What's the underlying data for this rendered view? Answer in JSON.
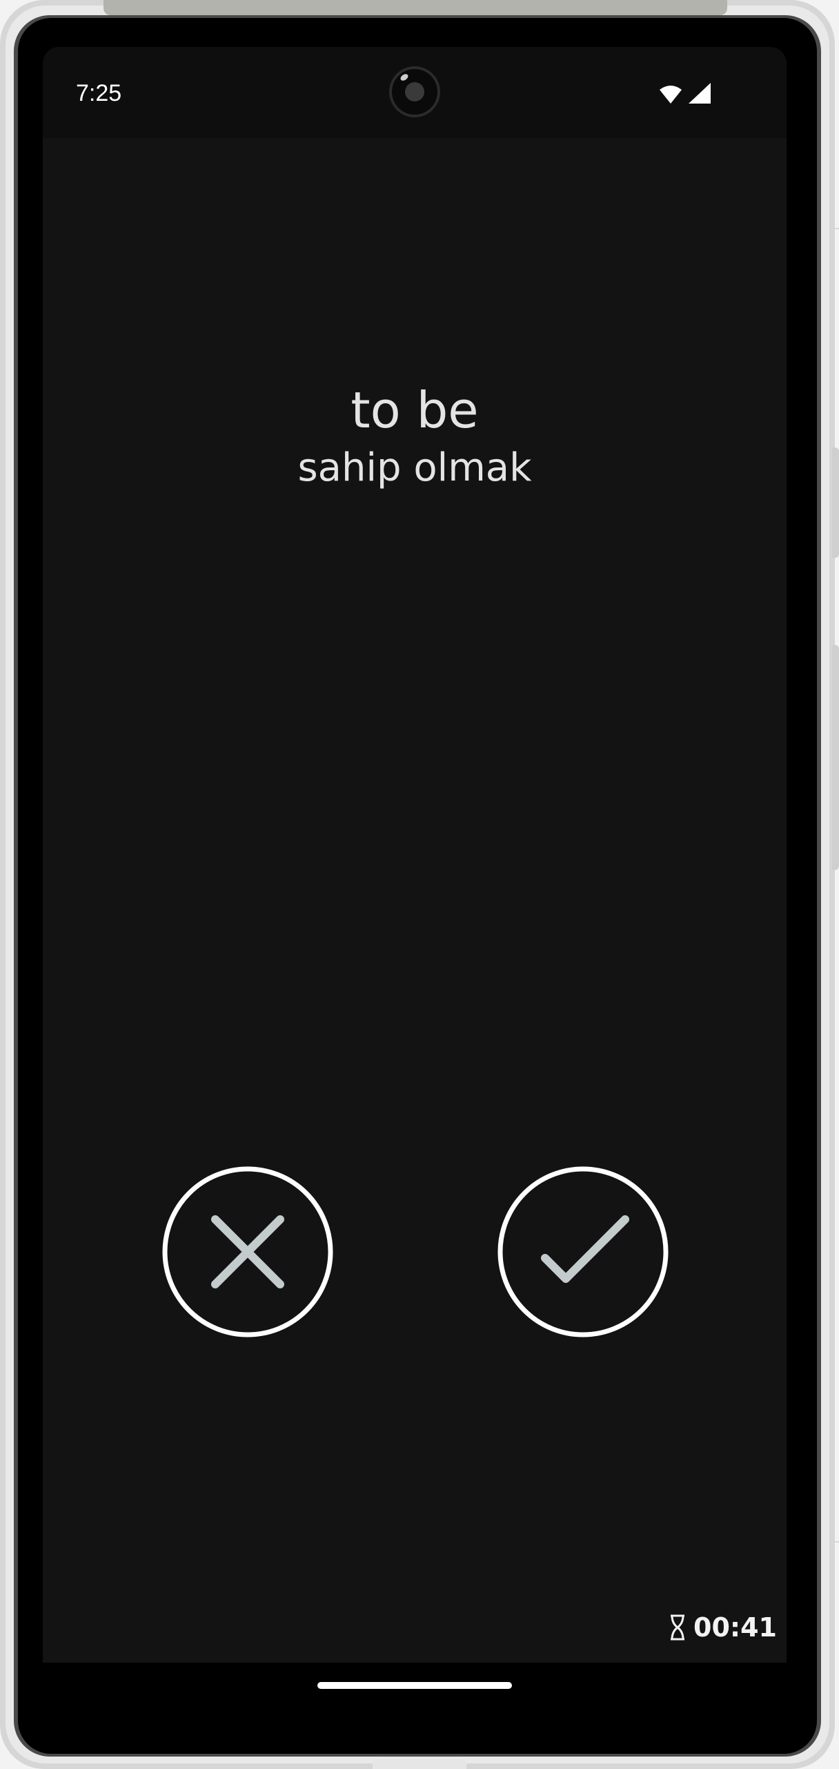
{
  "status_bar": {
    "time": "7:25",
    "icons": [
      "wifi-icon",
      "cellular-signal-icon"
    ]
  },
  "card": {
    "word": "to be",
    "translation": "sahip olmak"
  },
  "actions": {
    "wrong_icon": "close-icon",
    "right_icon": "check-icon"
  },
  "timer": {
    "icon": "hourglass-icon",
    "value": "00:41"
  },
  "colors": {
    "background": "#131313",
    "text": "#e4e4e4",
    "button_ring": "#ffffff",
    "button_glyph": "#c4cbcd"
  }
}
